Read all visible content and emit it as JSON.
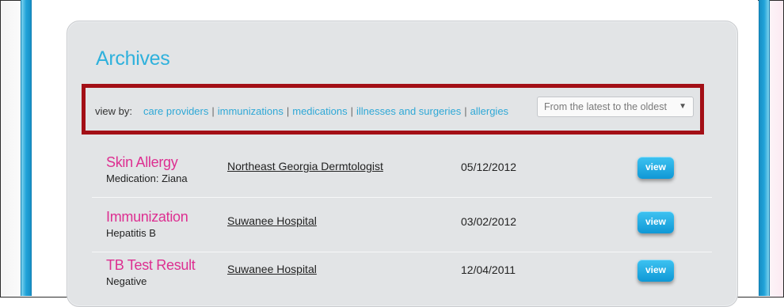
{
  "archives": {
    "title": "Archives",
    "view_by_label": "view by:",
    "filters": [
      "care providers",
      "immunizations",
      "medications",
      "illnesses and surgeries",
      "allergies"
    ],
    "sort": {
      "selected": "From the latest to the oldest",
      "icon": "triangle-down-icon"
    }
  },
  "records": [
    {
      "title": "Skin Allergy",
      "subtitle": "Medication: Ziana",
      "provider": "Northeast Georgia Dermtologist",
      "date": "05/12/2012",
      "action": "view"
    },
    {
      "title": "Immunization",
      "subtitle": "Hepatitis B",
      "provider": "Suwanee Hospital",
      "date": "03/02/2012",
      "action": "view"
    },
    {
      "title": "TB Test Result",
      "subtitle": "Negative",
      "provider": "Suwanee Hospital",
      "date": "12/04/2011",
      "action": "view"
    }
  ],
  "colors": {
    "accent_blue": "#2fb1dc",
    "record_title_pink": "#dd2f91",
    "highlight_red": "#a30f16",
    "button_blue": "#0f98d6"
  }
}
